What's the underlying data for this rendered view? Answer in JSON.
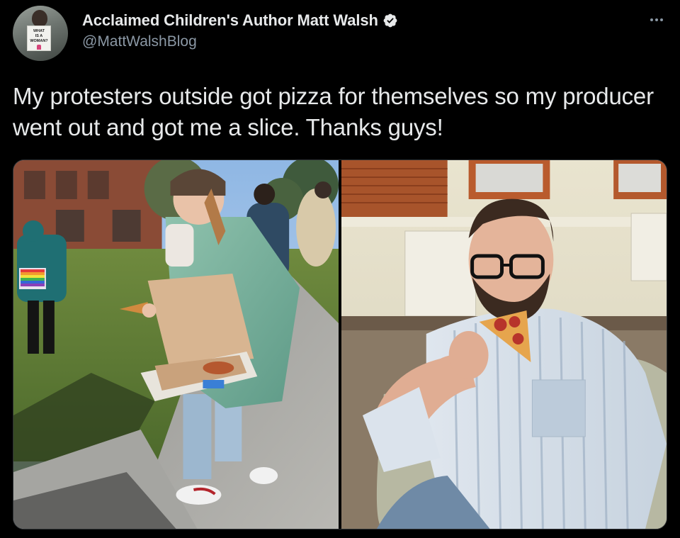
{
  "tweet": {
    "author": {
      "display_name": "Acclaimed Children's Author Matt Walsh",
      "handle": "@MattWalshBlog",
      "verified": true,
      "avatar_sign_text": "WHAT IS A WOMAN?"
    },
    "text": "My protesters outside got pizza for themselves so my producer went out and got me a slice. Thanks guys!",
    "media": [
      {
        "kind": "photo",
        "subject": "protester-with-pizza-box"
      },
      {
        "kind": "photo",
        "subject": "man-eating-pizza-slice"
      }
    ]
  },
  "icons": {
    "verified": "verified-badge-icon",
    "more": "more-options-icon"
  },
  "colors": {
    "background": "#000000",
    "primary_text": "#e7e9ea",
    "secondary_text": "#8b98a5",
    "verified_badge": "#e7e9ea",
    "border": "#2f3336"
  }
}
